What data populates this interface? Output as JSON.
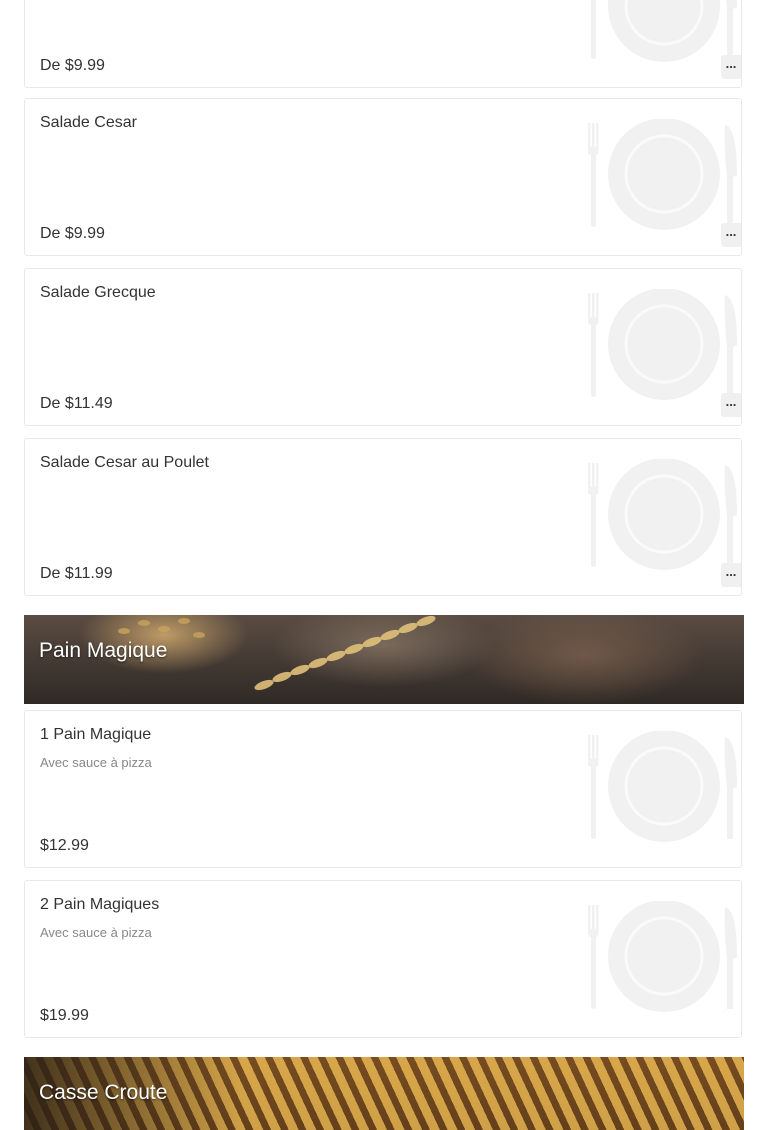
{
  "items_top": [
    {
      "name": "",
      "price": "De $9.99",
      "more": "..."
    },
    {
      "name": "Salade Cesar",
      "price": "De $9.99",
      "more": "..."
    },
    {
      "name": "Salade Grecque",
      "price": "De $11.49",
      "more": "..."
    },
    {
      "name": "Salade Cesar au Poulet",
      "price": "De $11.99",
      "more": "..."
    }
  ],
  "section_pain": {
    "title": "Pain Magique",
    "items": [
      {
        "name": "1 Pain Magique",
        "description": "Avec sauce à pizza",
        "price": "$12.99"
      },
      {
        "name": "2 Pain Magiques",
        "description": "Avec sauce à pizza",
        "price": "$19.99"
      }
    ]
  },
  "section_casse": {
    "title": "Casse Croute"
  },
  "icons": {
    "placeholder": "plate-fork-knife-icon"
  }
}
